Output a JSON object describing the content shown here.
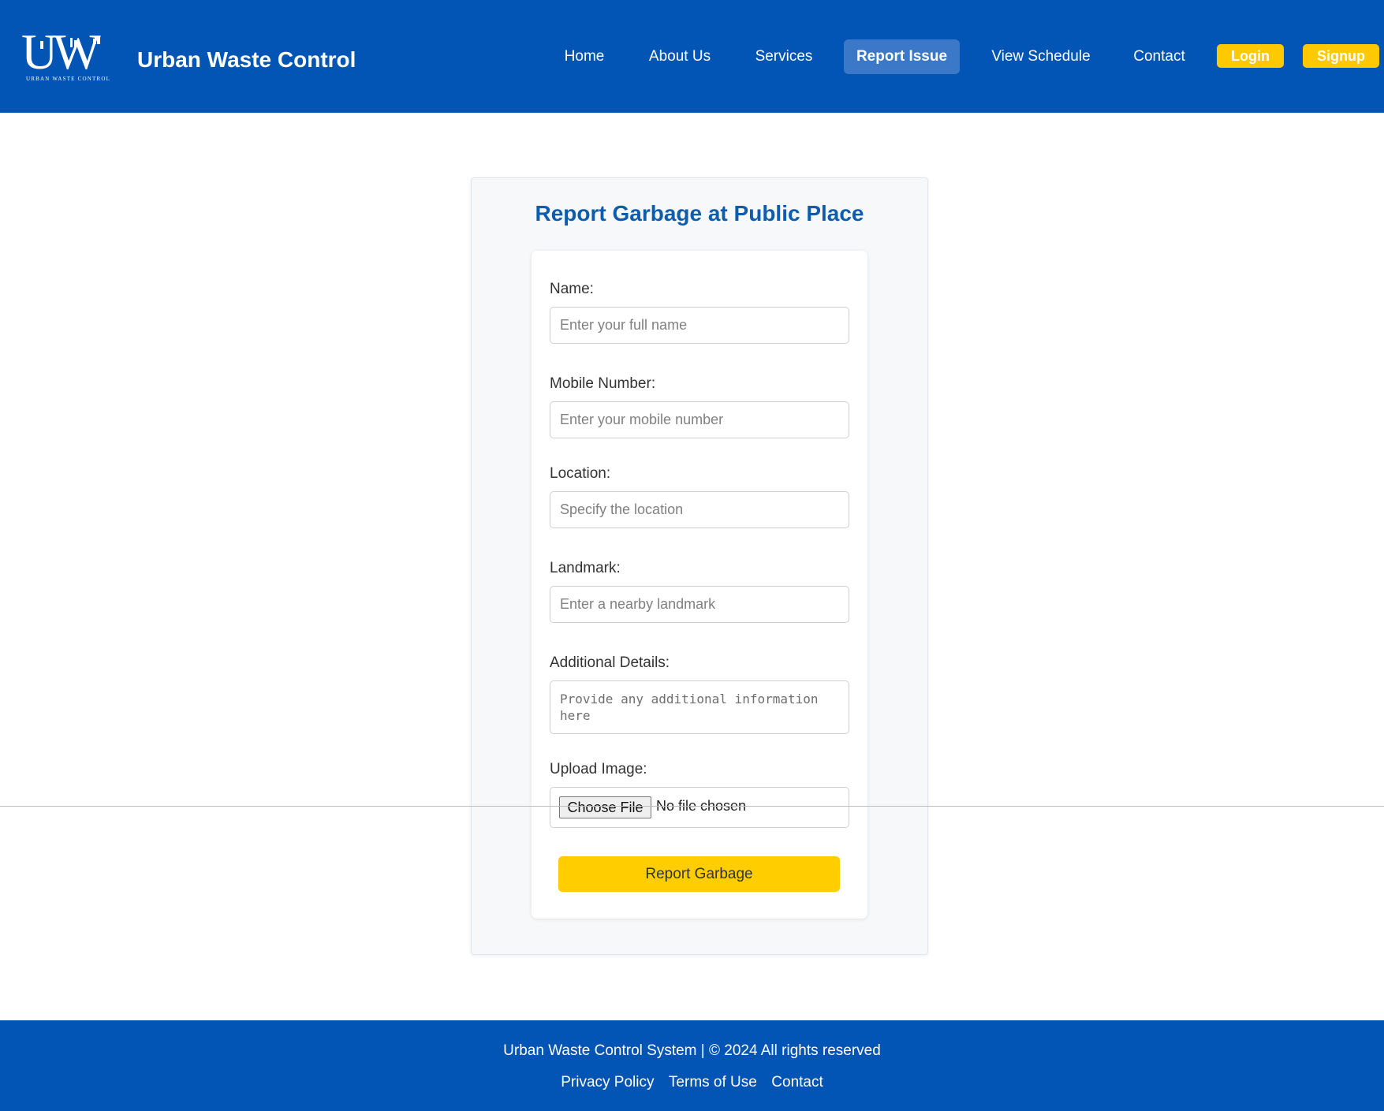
{
  "header": {
    "logo_mark": "UW",
    "logo_caption": "URBAN WASTE CONTROL",
    "brand_name": "Urban Waste Control",
    "nav": {
      "home": "Home",
      "about": "About Us",
      "services": "Services",
      "report": "Report Issue",
      "schedule": "View Schedule",
      "contact": "Contact"
    },
    "login_label": "Login",
    "signup_label": "Signup",
    "active_nav": "Report Issue"
  },
  "form": {
    "title": "Report Garbage at Public Place",
    "name_label": "Name:",
    "name_placeholder": "Enter your full name",
    "mobile_label": "Mobile Number:",
    "mobile_placeholder": "Enter your mobile number",
    "location_label": "Location:",
    "location_placeholder": "Specify the location",
    "landmark_label": "Landmark:",
    "landmark_placeholder": "Enter a nearby landmark",
    "details_label": "Additional Details:",
    "details_placeholder": "Provide any additional information here",
    "upload_label": "Upload Image:",
    "choose_file_label": "Choose File",
    "file_status": "No file chosen",
    "submit_label": "Report Garbage"
  },
  "footer": {
    "copyright": "Urban Waste Control System | © 2024 All rights reserved",
    "links": [
      "Privacy Policy",
      "Terms of Use",
      "Contact"
    ]
  },
  "colors": {
    "header_bg": "#0255b4",
    "accent_yellow": "#ffcd00",
    "title_blue": "#0e5cad"
  }
}
